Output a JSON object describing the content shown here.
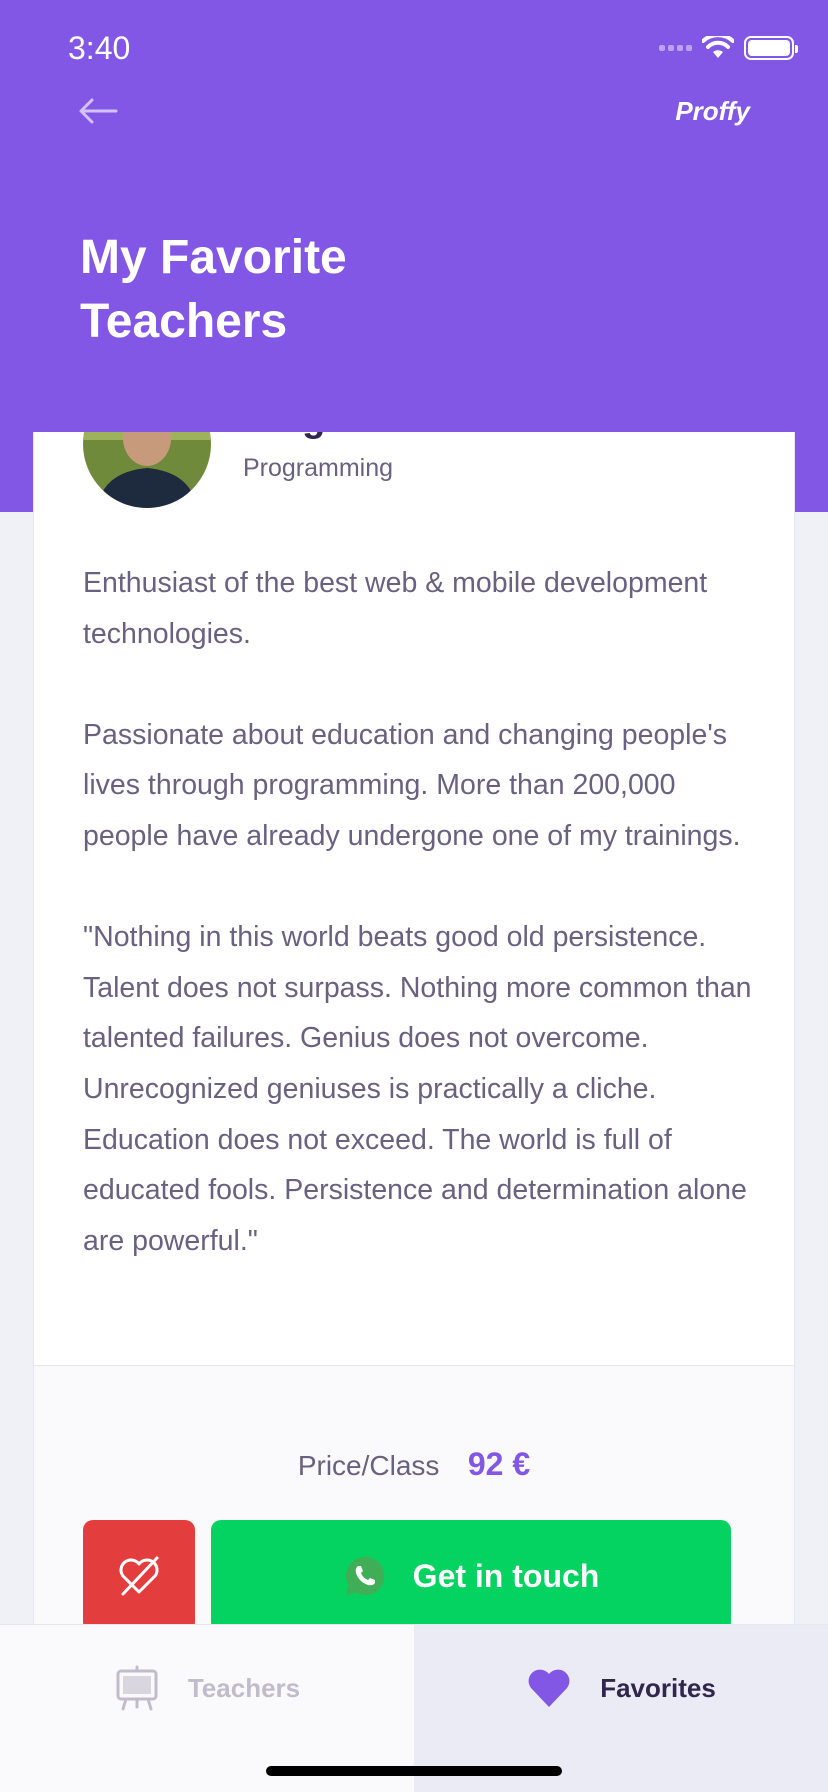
{
  "status_bar": {
    "time": "3:40"
  },
  "header": {
    "brand": "Proffy",
    "title": "My Favorite Teachers"
  },
  "teacher": {
    "name": "Diego Fernandes",
    "subject": "Programming",
    "bio": [
      "Enthusiast of the best web & mobile development technologies.",
      "Passionate about education and changing people's lives through programming. More than 200,000 people have already undergone one of my trainings.",
      "\"Nothing in this world beats good old persistence. Talent does not surpass. Nothing more common than talented failures. Genius does not overcome. Unrecognized geniuses is practically a cliche. Education does not exceed. The world is full of educated fools. Persistence and determination alone are powerful.\""
    ],
    "price_label": "Price/Class",
    "price_value": "92 €"
  },
  "actions": {
    "contact_label": "Get in touch"
  },
  "tabs": [
    {
      "label": "Teachers",
      "icon": "easel-icon",
      "active": false
    },
    {
      "label": "Favorites",
      "icon": "heart-icon",
      "active": true
    }
  ],
  "colors": {
    "primary": "#8257E5",
    "danger": "#E33D3D",
    "success": "#04D361"
  }
}
